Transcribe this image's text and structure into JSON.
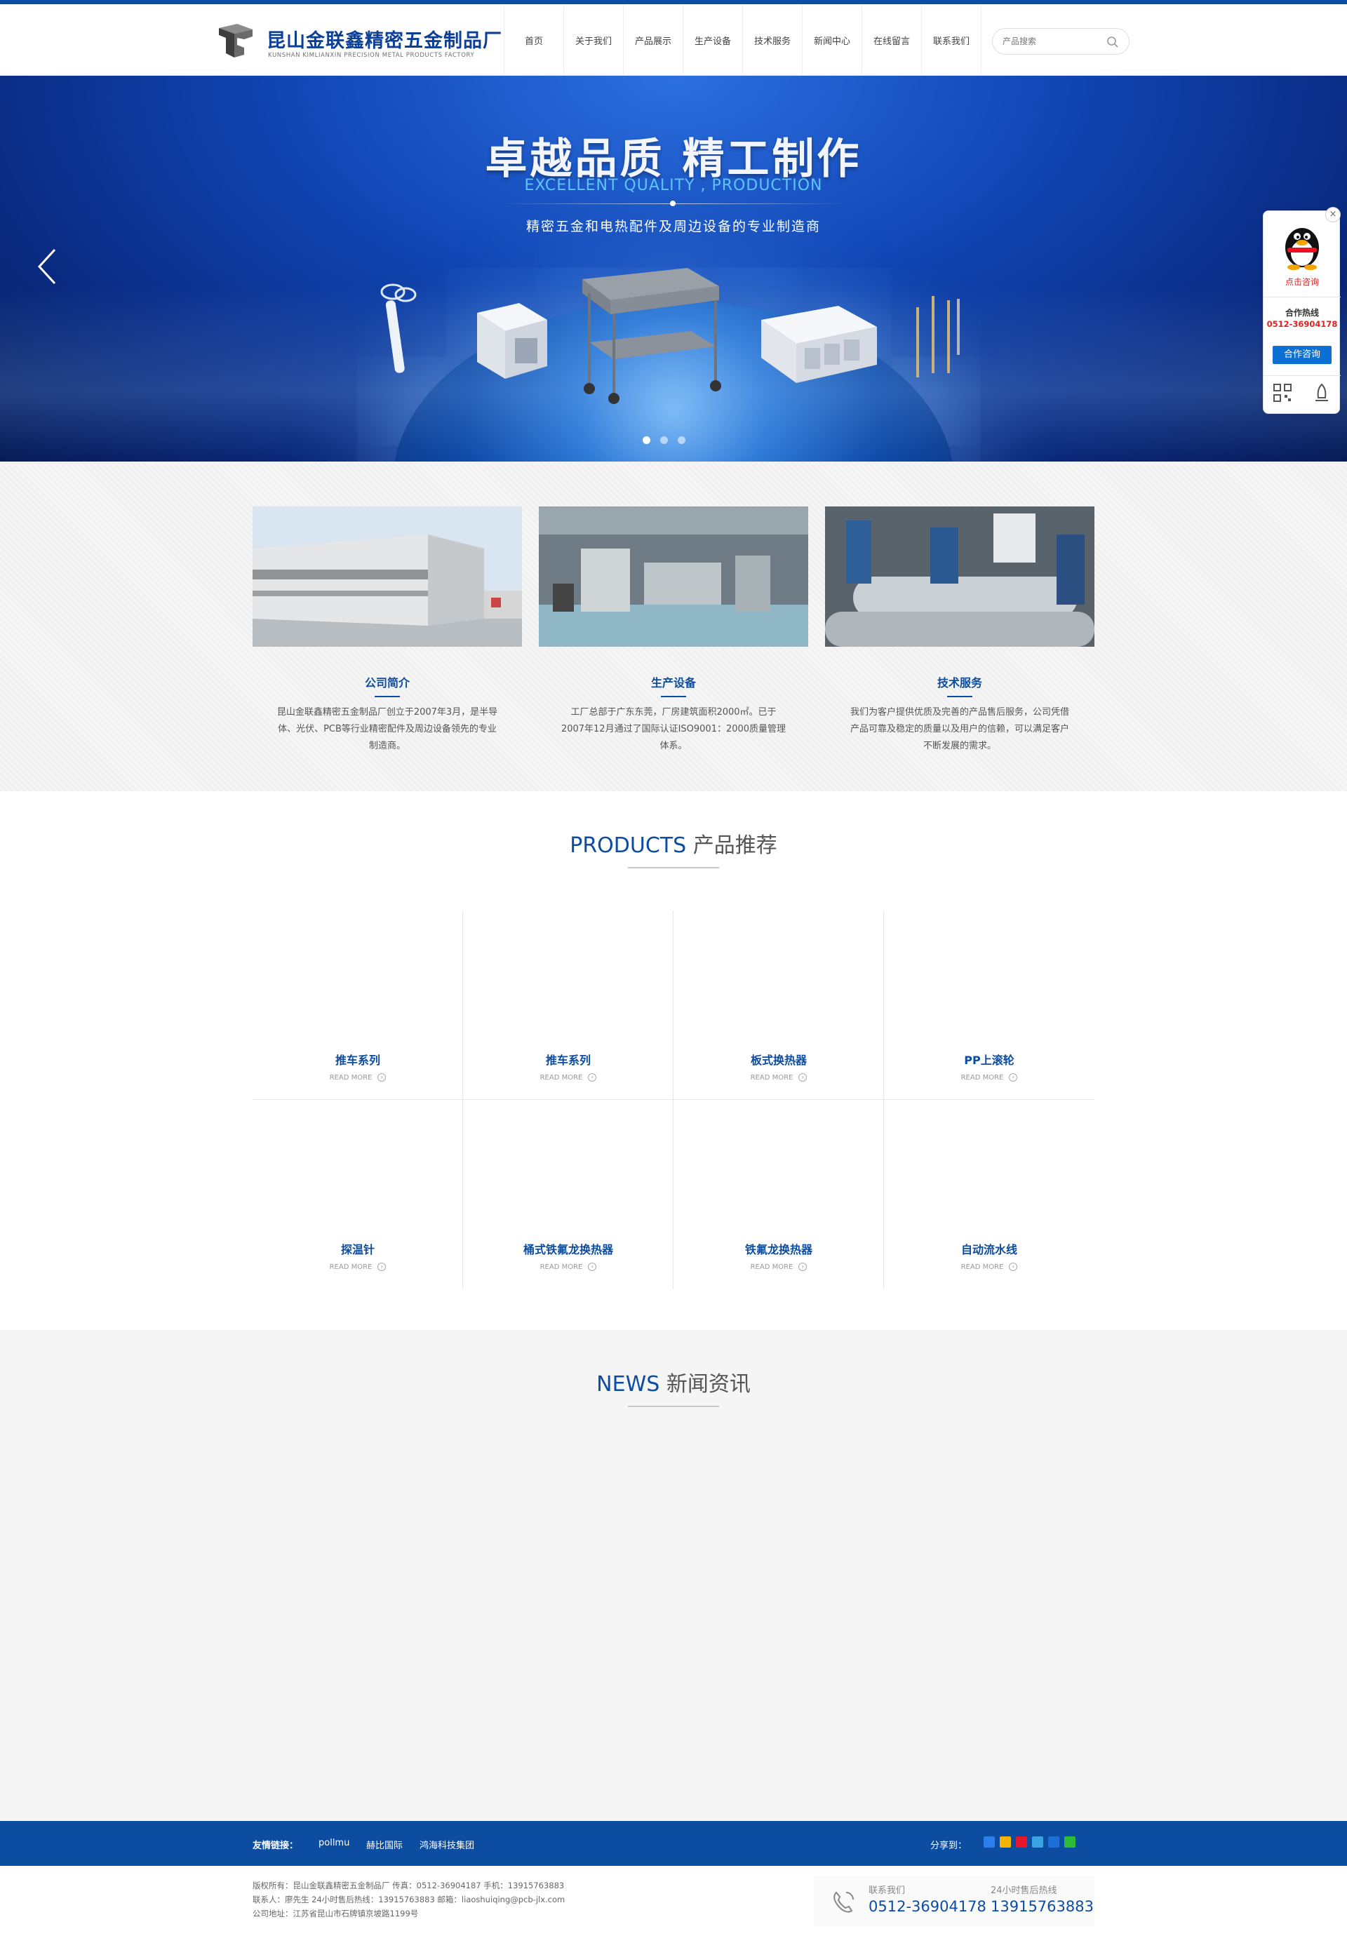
{
  "header": {
    "logo_title": "昆山金联鑫精密五金制品厂",
    "logo_subtitle": "KUNSHAN KIMLIANXIN PRECISION METAL PRODUCTS FACTORY",
    "nav": [
      "首页",
      "关于我们",
      "产品展示",
      "生产设备",
      "技术服务",
      "新闻中心",
      "在线留言",
      "联系我们"
    ],
    "search_placeholder": "产品搜索"
  },
  "banner": {
    "title": "卓越品质 精工制作",
    "subtitle_en": "EXCELLENT QUALITY , PRODUCTION",
    "subtitle_cn": "精密五金和电热配件及周边设备的专业制造商",
    "slide_count": 3,
    "active_slide": 1
  },
  "intro": [
    {
      "title": "公司简介",
      "text": "昆山金联鑫精密五金制品厂创立于2007年3月，是半导体、光伏、PCB等行业精密配件及周边设备领先的专业制造商。"
    },
    {
      "title": "生产设备",
      "text": "工厂总部于广东东莞，厂房建筑面积2000㎡。已于2007年12月通过了国际认证ISO9001：2000质量管理体系。"
    },
    {
      "title": "技术服务",
      "text": "我们为客户提供优质及完善的产品售后服务，公司凭借产品可靠及稳定的质量以及用户的信赖，可以满足客户不断发展的需求。"
    }
  ],
  "products": {
    "title_en": "PRODUCTS",
    "title_cn": "产品推荐",
    "read_more": "READ MORE",
    "items": [
      "推车系列",
      "推车系列",
      "板式换热器",
      "PP上滚轮",
      "探温针",
      "桶式铁氟龙换热器",
      "铁氟龙换热器",
      "自动流水线"
    ]
  },
  "news": {
    "title_en": "NEWS",
    "title_cn": "新闻资讯"
  },
  "footer": {
    "links_label": "友情链接：",
    "links": [
      "pollmu",
      "赫比国际",
      "鸿海科技集团"
    ],
    "share_label": "分享到：",
    "info": [
      "版权所有：昆山金联鑫精密五金制品厂 传真：0512-36904187 手机：13915763883",
      "联系人：廖先生 24小时售后热线：13915763883 邮箱：liaoshuiqing@pcb-jlx.com",
      "公司地址：江苏省昆山市石牌镇京坡路1199号"
    ],
    "contact_label": "联系我们",
    "contact_number": "0512-36904178",
    "hotline_label": "24小时售后热线",
    "hotline_number": "13915763883"
  },
  "float_widget": {
    "qq_label": "点击咨询",
    "hotline_label": "合作热线",
    "hotline_number": "0512-36904178",
    "button": "合作咨询",
    "close": "×"
  },
  "colors": {
    "brand_blue": "#0c4da2",
    "accent_red": "#dd2222"
  }
}
